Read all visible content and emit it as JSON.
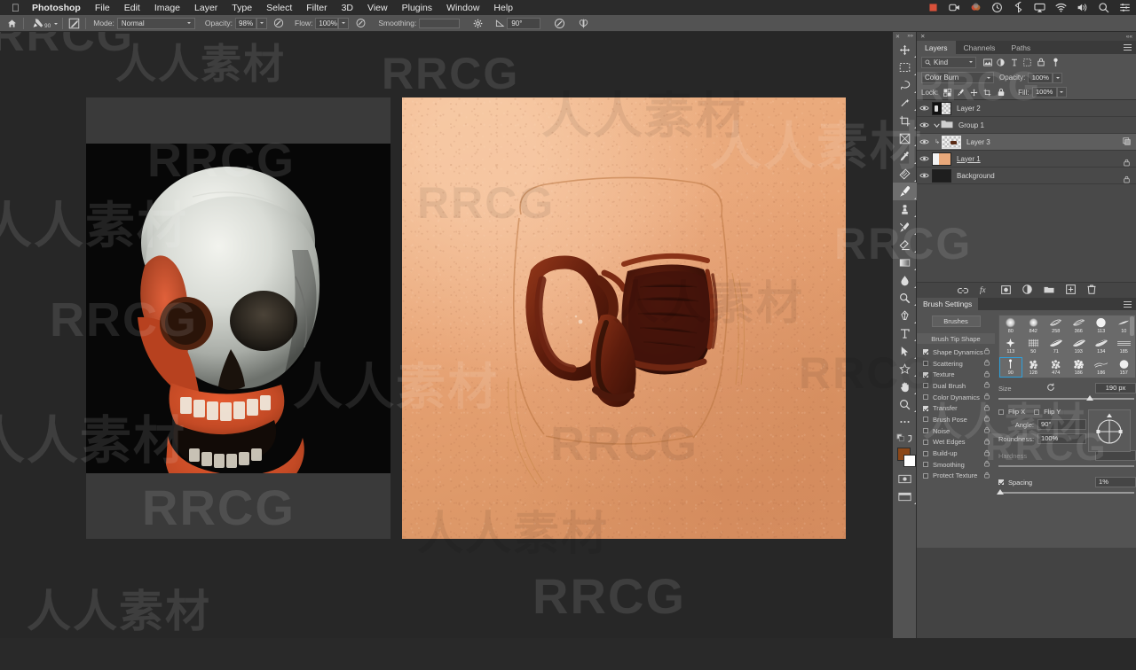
{
  "menubar": {
    "apple": "apple-logo",
    "items": [
      {
        "label": "Photoshop",
        "bold": true
      },
      {
        "label": "File",
        "bold": false
      },
      {
        "label": "Edit",
        "bold": false
      },
      {
        "label": "Image",
        "bold": false
      },
      {
        "label": "Layer",
        "bold": false
      },
      {
        "label": "Type",
        "bold": false
      },
      {
        "label": "Select",
        "bold": false
      },
      {
        "label": "Filter",
        "bold": false
      },
      {
        "label": "3D",
        "bold": false
      },
      {
        "label": "View",
        "bold": false
      },
      {
        "label": "Plugins",
        "bold": false
      },
      {
        "label": "Window",
        "bold": false
      },
      {
        "label": "Help",
        "bold": false
      }
    ],
    "status_icons": [
      "record-red-icon",
      "screen-record-icon",
      "color-wheel-icon",
      "time-machine-icon",
      "bluetooth-icon",
      "airplay-icon",
      "wifi-icon",
      "volume-icon",
      "spotlight-search-icon",
      "control-center-icon"
    ]
  },
  "options_bar": {
    "home_icon": "home-icon",
    "brush_preset_label": "90",
    "brush_preset_icon": "brush-preset-icon",
    "toggle_brush_panel_icon": "brush-panel-toggle-icon",
    "mode_label": "Mode:",
    "mode_value": "Normal",
    "opacity_label": "Opacity:",
    "opacity_value": "98%",
    "opacity_pressure_icon": "pressure-opacity-icon",
    "flow_label": "Flow:",
    "flow_value": "100%",
    "airbrush_icon": "airbrush-icon",
    "smoothing_label": "Smoothing:",
    "smoothing_options_icon": "gear-icon",
    "angle_label": "90°",
    "angle_icon": "angle-icon",
    "symmetry_icon": "symmetry-butterfly-icon",
    "tablet_pressure_icon": "tablet-pressure-icon"
  },
  "toolbar": {
    "tools": [
      {
        "name": "move-tool",
        "icon": "move",
        "active": false
      },
      {
        "name": "rectangular-marquee-tool",
        "icon": "marquee",
        "active": false
      },
      {
        "name": "lasso-tool",
        "icon": "lasso",
        "active": false
      },
      {
        "name": "object-selection-tool",
        "icon": "wand",
        "active": false
      },
      {
        "name": "crop-tool",
        "icon": "crop",
        "active": false
      },
      {
        "name": "frame-tool",
        "icon": "frame",
        "active": false
      },
      {
        "name": "eyedropper-tool",
        "icon": "eyedropper",
        "active": false
      },
      {
        "name": "spot-healing-brush-tool",
        "icon": "healing",
        "active": false
      },
      {
        "name": "brush-tool",
        "icon": "brush",
        "active": true
      },
      {
        "name": "clone-stamp-tool",
        "icon": "stamp",
        "active": false
      },
      {
        "name": "history-brush-tool",
        "icon": "historybrush",
        "active": false
      },
      {
        "name": "eraser-tool",
        "icon": "eraser",
        "active": false
      },
      {
        "name": "gradient-tool",
        "icon": "gradient",
        "active": false
      },
      {
        "name": "blur-tool",
        "icon": "blur",
        "active": false
      },
      {
        "name": "dodge-tool",
        "icon": "dodge",
        "active": false
      },
      {
        "name": "pen-tool",
        "icon": "pen",
        "active": false
      },
      {
        "name": "type-tool",
        "icon": "type",
        "active": false
      },
      {
        "name": "path-selection-tool",
        "icon": "pathselect",
        "active": false
      },
      {
        "name": "custom-shape-tool",
        "icon": "shape",
        "active": false
      },
      {
        "name": "hand-tool",
        "icon": "hand",
        "active": false
      },
      {
        "name": "zoom-tool",
        "icon": "zoom",
        "active": false
      },
      {
        "name": "edit-toolbar-button",
        "icon": "dots",
        "active": false
      }
    ],
    "foreground_color": "#8b4718",
    "background_color": "#ffffff",
    "quick_mask_icon": "quick-mask-icon",
    "screen_mode_icon": "screen-mode-icon",
    "swap_colors_icon": "swap-colors-icon",
    "default_colors_icon": "default-colors-icon"
  },
  "layers_panel": {
    "close_icon": "close-icon",
    "collapse_icon": "collapse-icon",
    "tabs": [
      {
        "label": "Layers",
        "selected": true
      },
      {
        "label": "Channels",
        "selected": false
      },
      {
        "label": "Paths",
        "selected": false
      }
    ],
    "menu_icon": "panel-menu-icon",
    "filter": {
      "search_icon": "search-icon",
      "kind_label": "Kind",
      "filter_icons": [
        "pixel-filter-icon",
        "adjustment-filter-icon",
        "type-filter-icon",
        "shape-filter-icon",
        "smart-object-filter-icon"
      ],
      "toggle_icon": "filter-toggle-icon"
    },
    "blend_mode": "Color Burn",
    "opacity_label": "Opacity:",
    "opacity_value": "100%",
    "lock_label": "Lock:",
    "lock_icons": [
      "lock-transparent-pixels-icon",
      "lock-image-pixels-icon",
      "lock-position-icon",
      "lock-artboard-icon",
      "lock-all-icon"
    ],
    "fill_label": "Fill:",
    "fill_value": "100%",
    "layers": [
      {
        "name": "Layer 2",
        "visible": true,
        "selected": false,
        "indent": 0,
        "type": "layer",
        "thumb": "mask-thumb",
        "locked": false,
        "underline": false
      },
      {
        "name": "Group 1",
        "visible": true,
        "selected": false,
        "indent": 0,
        "type": "group",
        "thumb": "folder",
        "locked": false,
        "underline": false
      },
      {
        "name": "Layer 3",
        "visible": true,
        "selected": true,
        "indent": 1,
        "type": "layer",
        "thumb": "transparent-thumb",
        "locked": false,
        "underline": false,
        "clipped": true,
        "right_icon": "smart-filter-icon"
      },
      {
        "name": "Layer 1",
        "visible": true,
        "selected": false,
        "indent": 0,
        "type": "layer",
        "thumb": "skin-thumb",
        "locked": true,
        "underline": true
      },
      {
        "name": "Background",
        "visible": true,
        "selected": false,
        "indent": 0,
        "type": "layer",
        "thumb": "dark-thumb",
        "locked": true,
        "underline": false
      }
    ],
    "footer_icons": [
      "link-layers-icon",
      "layer-style-fx-icon",
      "add-layer-mask-icon",
      "new-adjustment-layer-icon",
      "new-group-icon",
      "new-layer-icon",
      "delete-layer-icon"
    ]
  },
  "brush_panel": {
    "tabs": [
      {
        "label": "Brush Settings",
        "selected": true
      }
    ],
    "brushes_button": "Brushes",
    "brush_tip_shape": "Brush Tip Shape",
    "options": [
      {
        "label": "Shape Dynamics",
        "checked": true,
        "locked": true
      },
      {
        "label": "Scattering",
        "checked": false,
        "locked": true
      },
      {
        "label": "Texture",
        "checked": true,
        "locked": true
      },
      {
        "label": "Dual Brush",
        "checked": false,
        "locked": true
      },
      {
        "label": "Color Dynamics",
        "checked": false,
        "locked": true
      },
      {
        "label": "Transfer",
        "checked": true,
        "locked": true
      },
      {
        "label": "Brush Pose",
        "checked": false,
        "locked": true
      },
      {
        "label": "Noise",
        "checked": false,
        "locked": true
      },
      {
        "label": "Wet Edges",
        "checked": false,
        "locked": true
      },
      {
        "label": "Build-up",
        "checked": false,
        "locked": true
      },
      {
        "label": "Smoothing",
        "checked": false,
        "locked": true
      },
      {
        "label": "Protect Texture",
        "checked": false,
        "locked": true
      }
    ],
    "brush_grid": [
      {
        "num": "80",
        "shape": "soft-round",
        "selected": false
      },
      {
        "num": "842",
        "shape": "soft-round",
        "selected": false
      },
      {
        "num": "258",
        "shape": "flat-bristle",
        "selected": false
      },
      {
        "num": "366",
        "shape": "flat-bristle",
        "selected": false
      },
      {
        "num": "113",
        "shape": "hard-round",
        "selected": false
      },
      {
        "num": "10",
        "shape": "flick",
        "selected": false
      },
      {
        "num": "113",
        "shape": "star",
        "selected": false
      },
      {
        "num": "50",
        "shape": "grid-tex",
        "selected": false
      },
      {
        "num": "71",
        "shape": "flat-bristle",
        "selected": false
      },
      {
        "num": "193",
        "shape": "flat-bristle",
        "selected": false
      },
      {
        "num": "134",
        "shape": "flat-bristle",
        "selected": false
      },
      {
        "num": "185",
        "shape": "streak",
        "selected": false
      },
      {
        "num": "90",
        "shape": "line-vertical",
        "selected": true
      },
      {
        "num": "128",
        "shape": "speckle",
        "selected": false
      },
      {
        "num": "474",
        "shape": "speckle",
        "selected": false
      },
      {
        "num": "186",
        "shape": "speckle-dense",
        "selected": false
      },
      {
        "num": "186",
        "shape": "wisp",
        "selected": false
      },
      {
        "num": "157",
        "shape": "soft-round",
        "selected": false
      }
    ],
    "size_label": "Size",
    "size_value": "190 px",
    "reset_icon": "reset-brush-icon",
    "flip_x_label": "Flip X",
    "flip_x_checked": false,
    "flip_y_label": "Flip Y",
    "flip_y_checked": false,
    "angle_label": "Angle:",
    "angle_value": "90°",
    "roundness_label": "Roundness:",
    "roundness_value": "100%",
    "hardness_label": "Hardness",
    "hardness_value": "",
    "spacing_label": "Spacing",
    "spacing_checked": true,
    "spacing_value": "1%"
  },
  "promo": {
    "brand": "RRCG",
    "brand_cjk": "人人素材",
    "logo_color": "#1fa4e8"
  },
  "watermarks": {
    "text_latin": "RRCG",
    "text_cjk": "人人素材"
  },
  "canvas": {
    "reference_pane_name": "skull-reference-image",
    "painting_pane_name": "skull-painting-canvas"
  }
}
